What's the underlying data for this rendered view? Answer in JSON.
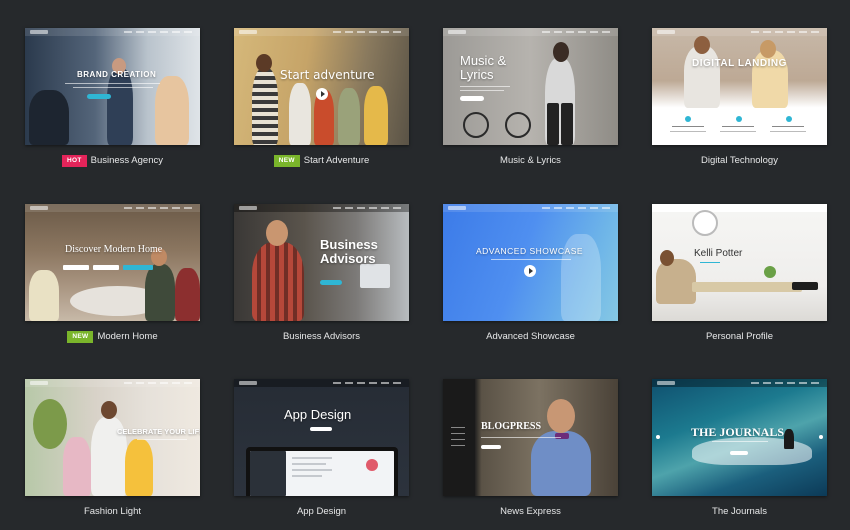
{
  "colors": {
    "background": "#26292c",
    "hot_badge": "#e4245a",
    "new_badge": "#7ab52b",
    "caption_text": "#e6e7e8"
  },
  "demos": [
    {
      "label": "Business Agency",
      "badge": "HOT",
      "hero": "BRAND CREATION"
    },
    {
      "label": "Start Adventure",
      "badge": "NEW",
      "hero": "Start adventure"
    },
    {
      "label": "Music & Lyrics",
      "badge": "",
      "hero": "Music &\nLyrics"
    },
    {
      "label": "Digital Technology",
      "badge": "",
      "hero": "DIGITAL LANDING"
    },
    {
      "label": "Modern Home",
      "badge": "NEW",
      "hero": "Discover Modern Home"
    },
    {
      "label": "Business Advisors",
      "badge": "",
      "hero": "Business\nAdvisors"
    },
    {
      "label": "Advanced Showcase",
      "badge": "",
      "hero": "ADVANCED SHOWCASE"
    },
    {
      "label": "Personal Profile",
      "badge": "",
      "hero": "Kelli Potter"
    },
    {
      "label": "Fashion Light",
      "badge": "",
      "hero": "CELEBRATE YOUR LIFE"
    },
    {
      "label": "App Design",
      "badge": "",
      "hero": "App Design"
    },
    {
      "label": "News Express",
      "badge": "",
      "hero": "BLOGPRESS"
    },
    {
      "label": "The Journals",
      "badge": "",
      "hero": "THE JOURNALS"
    }
  ]
}
